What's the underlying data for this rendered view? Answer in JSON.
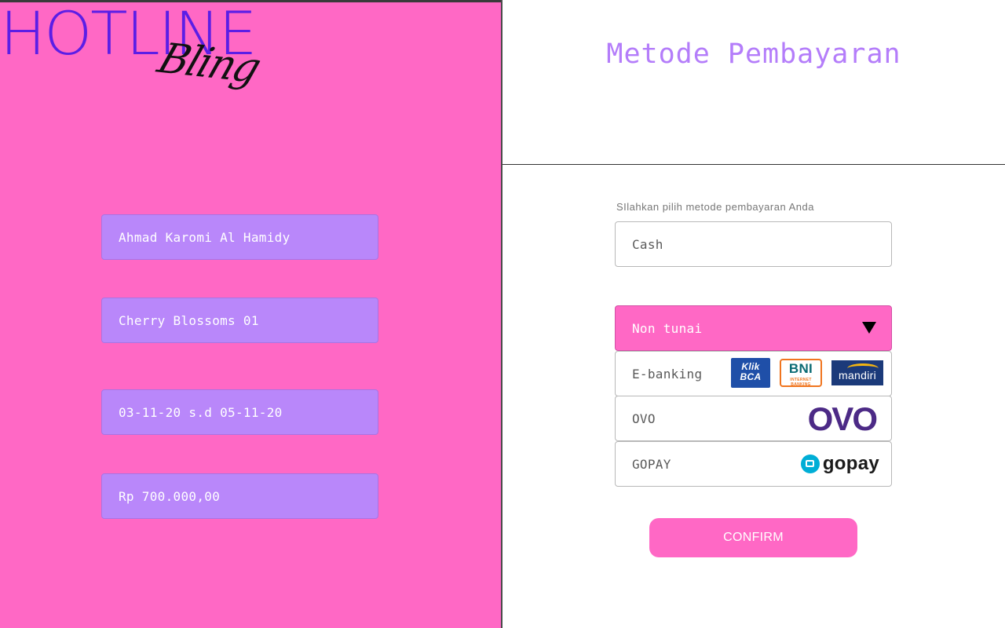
{
  "brand": {
    "name": "HOTLINE",
    "script": "Bling",
    "color": "#5b1ee6",
    "panel_color": "#ff68c5"
  },
  "booking": {
    "name": "Ahmad Karomi Al Hamidy",
    "room": "Cherry Blossoms 01",
    "dates": "03-11-20 s.d 05-11-20",
    "price": "Rp 700.000,00"
  },
  "payment": {
    "title": "Metode Pembayaran",
    "instruction": "SIlahkan pilih metode pembayaran Anda",
    "cash_label": "Cash",
    "noncash_label": "Non tunai",
    "options": {
      "ebanking": "E-banking",
      "ovo": "OVO",
      "gopay": "GOPAY"
    },
    "bank_logos": {
      "bca_line1": "Klik",
      "bca_line2": "BCA",
      "bni": "BNI",
      "bni_sub": "INTERNET BANKING",
      "mandiri": "mandiri"
    },
    "ovo_logo": "OVO",
    "gopay_logo": "gopay",
    "confirm_label": "CONFIRM",
    "accent": "#ff68c5",
    "title_color": "#b47dfa"
  }
}
